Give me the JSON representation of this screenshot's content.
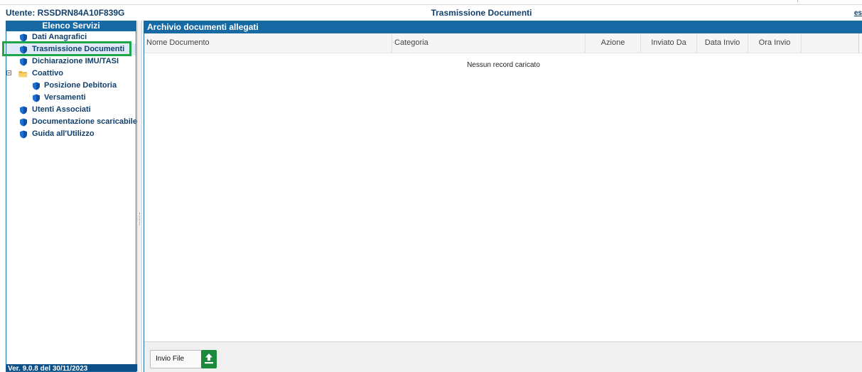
{
  "header": {
    "user_label": "Utente: RSSDRN84A10F839G",
    "title": "Trasmissione Documenti",
    "exit_label": "es"
  },
  "sidebar": {
    "title": "Elenco Servizi",
    "items": [
      {
        "label": "Dati Anagrafici",
        "icon": "shield-icon",
        "level": 0
      },
      {
        "label": "Trasmissione Documenti",
        "icon": "shield-icon",
        "level": 0,
        "selected": true
      },
      {
        "label": "Dichiarazione IMU/TASI",
        "icon": "shield-icon",
        "level": 0
      },
      {
        "label": "Coattivo",
        "icon": "folder-icon",
        "level": 0,
        "expanded": true
      },
      {
        "label": "Posizione Debitoria",
        "icon": "shield-icon",
        "level": 1
      },
      {
        "label": "Versamenti",
        "icon": "shield-icon",
        "level": 1
      },
      {
        "label": "Utenti Associati",
        "icon": "shield-icon",
        "level": 0
      },
      {
        "label": "Documentazione scaricabile",
        "icon": "shield-icon",
        "level": 0
      },
      {
        "label": "Guida all'Utilizzo",
        "icon": "shield-icon",
        "level": 0
      }
    ],
    "version": "Ver. 9.0.8 del 30/11/2023"
  },
  "main": {
    "panel_title": "Archivio documenti allegati",
    "columns": [
      "Nome Documento",
      "Categoria",
      "Azione",
      "Inviato Da",
      "Data Invio",
      "Ora Invio"
    ],
    "empty_message": "Nessun record caricato",
    "upload_label": "Invio File"
  },
  "colors": {
    "header_blue": "#1769a4",
    "text_blue": "#12406b",
    "selection_green": "#1fa54a",
    "upload_green": "#1c8a3c"
  }
}
